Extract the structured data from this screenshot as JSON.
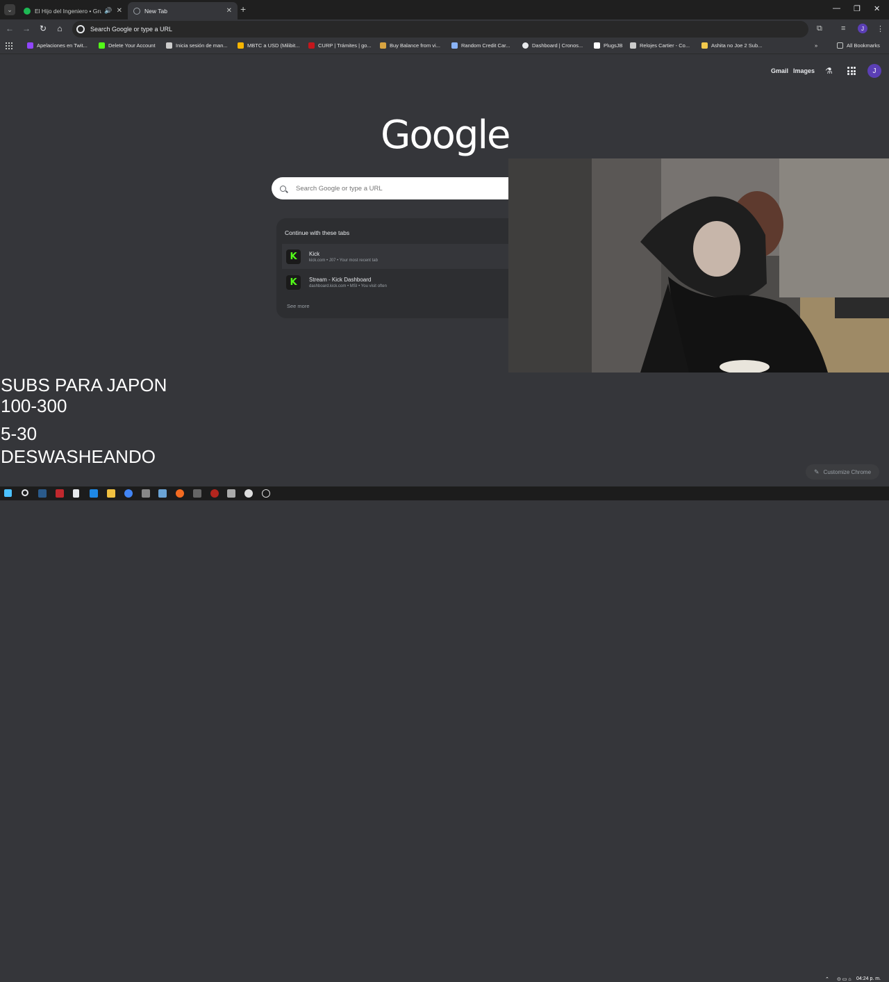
{
  "tabs": [
    {
      "title": "El Hijo del Ingeniero • Grup",
      "favicon_color": "#1db954"
    },
    {
      "title": "New Tab",
      "favicon_color": "#9aa0a6"
    }
  ],
  "window_controls": {
    "minimize": "—",
    "restore": "❐",
    "close": "✕"
  },
  "omnibox": {
    "text": "Search Google or type a URL"
  },
  "profile_initial": "J",
  "bookmarks": [
    {
      "label": "Apelaciones en Twit...",
      "color": "#9146ff"
    },
    {
      "label": "Delete Your Account",
      "color": "#53fc18"
    },
    {
      "label": "Inicia sesión de man...",
      "color": "#cccccc"
    },
    {
      "label": "MBTC a USD (Milibit...",
      "color": "#f7b500"
    },
    {
      "label": "CURP | Trámites | go...",
      "color": "#c4161c"
    },
    {
      "label": "Buy Balance from vi...",
      "color": "#d9a441"
    },
    {
      "label": "Random Credit Car...",
      "color": "#8ab4f8"
    },
    {
      "label": "Dashboard | Cronos...",
      "color": "#e8eaed"
    },
    {
      "label": "PlugsJB",
      "color": "#ffffff"
    },
    {
      "label": "Relojes Cartier - Co...",
      "color": "#cccccc"
    },
    {
      "label": "Ashita no Joe 2 Sub...",
      "color": "#f2c94c"
    }
  ],
  "all_bookmarks": "All Bookmarks",
  "ntp": {
    "links": {
      "gmail": "Gmail",
      "images": "Images"
    },
    "logo": "Google",
    "search_placeholder": "Search Google or type a URL",
    "continue": {
      "header": "Continue with these tabs",
      "items": [
        {
          "title": "Kick",
          "subtitle": "kick.com • J07 • Your most recent tab"
        },
        {
          "title": "Stream - Kick Dashboard",
          "subtitle": "dashboard.kick.com • MSI • You visit often"
        }
      ],
      "see_more": "See more"
    },
    "customize": "Customize Chrome"
  },
  "overlay": {
    "line1": "SUBS PARA JAPON",
    "line2": "100-300",
    "line3": "5-30",
    "line4": "DESWASHEANDO"
  },
  "taskbar": {
    "time": "04:24 p. m."
  }
}
